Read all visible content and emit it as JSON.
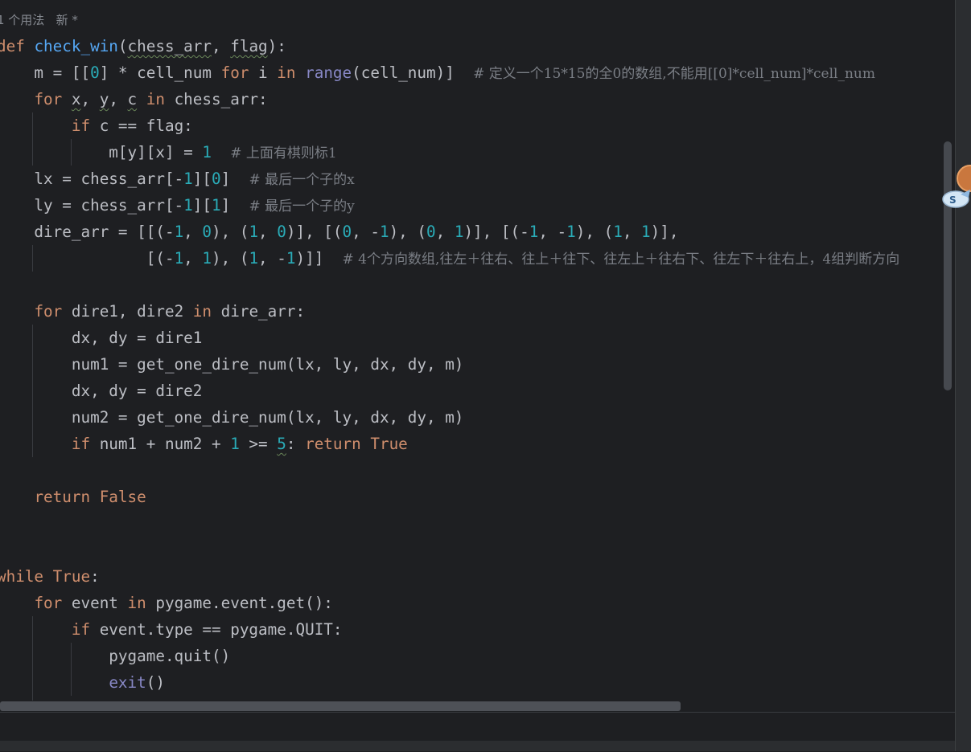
{
  "editor": {
    "usage_hint": "1 个用法   新 *",
    "lines": [
      {
        "id": "l1",
        "tokens": [
          {
            "t": "def ",
            "c": "kw"
          },
          {
            "t": "check_win",
            "c": "fn"
          },
          {
            "t": "("
          },
          {
            "t": "chess_arr",
            "c": "sq"
          },
          {
            "t": ", "
          },
          {
            "t": "flag",
            "c": "sq"
          },
          {
            "t": "):"
          }
        ]
      },
      {
        "id": "l2",
        "tokens": [
          {
            "t": "    m = [["
          },
          {
            "t": "0",
            "c": "num"
          },
          {
            "t": "] * cell_num "
          },
          {
            "t": "for",
            "c": "kw"
          },
          {
            "t": " i "
          },
          {
            "t": "in",
            "c": "kw"
          },
          {
            "t": " "
          },
          {
            "t": "range",
            "c": "bi"
          },
          {
            "t": "(cell_num)]  "
          },
          {
            "t": "# 定义一个15*15的全0的数组,不能用[[0]*cell_num]*cell_num",
            "c": "cm"
          }
        ]
      },
      {
        "id": "l3",
        "tokens": [
          {
            "t": "    "
          },
          {
            "t": "for",
            "c": "kw"
          },
          {
            "t": " "
          },
          {
            "t": "x",
            "c": "sq"
          },
          {
            "t": ", "
          },
          {
            "t": "y",
            "c": "sq"
          },
          {
            "t": ", "
          },
          {
            "t": "c",
            "c": "sq"
          },
          {
            "t": " "
          },
          {
            "t": "in",
            "c": "kw"
          },
          {
            "t": " chess_arr:"
          }
        ]
      },
      {
        "id": "l4",
        "tokens": [
          {
            "t": "        "
          },
          {
            "t": "if",
            "c": "kw"
          },
          {
            "t": " c == flag:"
          }
        ]
      },
      {
        "id": "l5",
        "tokens": [
          {
            "t": "            m[y][x] = "
          },
          {
            "t": "1",
            "c": "num"
          },
          {
            "t": "  "
          },
          {
            "t": "# 上面有棋则标1",
            "c": "cm"
          }
        ]
      },
      {
        "id": "l6",
        "tokens": [
          {
            "t": "    lx = chess_arr[-"
          },
          {
            "t": "1",
            "c": "num"
          },
          {
            "t": "]["
          },
          {
            "t": "0",
            "c": "num"
          },
          {
            "t": "]  "
          },
          {
            "t": "# 最后一个子的x",
            "c": "cm"
          }
        ]
      },
      {
        "id": "l7",
        "tokens": [
          {
            "t": "    ly = chess_arr[-"
          },
          {
            "t": "1",
            "c": "num"
          },
          {
            "t": "]["
          },
          {
            "t": "1",
            "c": "num"
          },
          {
            "t": "]  "
          },
          {
            "t": "# 最后一个子的y",
            "c": "cm"
          }
        ]
      },
      {
        "id": "l8",
        "tokens": [
          {
            "t": "    dire_arr = [[(-"
          },
          {
            "t": "1",
            "c": "num"
          },
          {
            "t": ", "
          },
          {
            "t": "0",
            "c": "num"
          },
          {
            "t": "), ("
          },
          {
            "t": "1",
            "c": "num"
          },
          {
            "t": ", "
          },
          {
            "t": "0",
            "c": "num"
          },
          {
            "t": ")], [("
          },
          {
            "t": "0",
            "c": "num"
          },
          {
            "t": ", -"
          },
          {
            "t": "1",
            "c": "num"
          },
          {
            "t": "), ("
          },
          {
            "t": "0",
            "c": "num"
          },
          {
            "t": ", "
          },
          {
            "t": "1",
            "c": "num"
          },
          {
            "t": ")], [(-"
          },
          {
            "t": "1",
            "c": "num"
          },
          {
            "t": ", -"
          },
          {
            "t": "1",
            "c": "num"
          },
          {
            "t": "), ("
          },
          {
            "t": "1",
            "c": "num"
          },
          {
            "t": ", "
          },
          {
            "t": "1",
            "c": "num"
          },
          {
            "t": ")],"
          }
        ]
      },
      {
        "id": "l9",
        "tokens": [
          {
            "t": "                [(-"
          },
          {
            "t": "1",
            "c": "num"
          },
          {
            "t": ", "
          },
          {
            "t": "1",
            "c": "num"
          },
          {
            "t": "), ("
          },
          {
            "t": "1",
            "c": "num"
          },
          {
            "t": ", -"
          },
          {
            "t": "1",
            "c": "num"
          },
          {
            "t": ")]]  "
          },
          {
            "t": "# 4个方向数组,往左＋往右、往上＋往下、往左上＋往右下、往左下＋往右上，4组判断方向",
            "c": "cm"
          }
        ]
      },
      {
        "id": "l10",
        "tokens": [
          {
            "t": ""
          }
        ]
      },
      {
        "id": "l11",
        "tokens": [
          {
            "t": "    "
          },
          {
            "t": "for",
            "c": "kw"
          },
          {
            "t": " dire1, dire2 "
          },
          {
            "t": "in",
            "c": "kw"
          },
          {
            "t": " dire_arr:"
          }
        ]
      },
      {
        "id": "l12",
        "tokens": [
          {
            "t": "        dx, dy = dire1"
          }
        ]
      },
      {
        "id": "l13",
        "tokens": [
          {
            "t": "        num1 = get_one_dire_num(lx, ly, dx, dy, m)"
          }
        ]
      },
      {
        "id": "l14",
        "tokens": [
          {
            "t": "        dx, dy = dire2"
          }
        ]
      },
      {
        "id": "l15",
        "tokens": [
          {
            "t": "        num2 = get_one_dire_num(lx, ly, dx, dy, m)"
          }
        ]
      },
      {
        "id": "l16",
        "tokens": [
          {
            "t": "        "
          },
          {
            "t": "if",
            "c": "kw"
          },
          {
            "t": " num1 + num2 + "
          },
          {
            "t": "1",
            "c": "num"
          },
          {
            "t": " >= "
          },
          {
            "t": "5",
            "c": "num sq"
          },
          {
            "t": ": "
          },
          {
            "t": "return",
            "c": "kw"
          },
          {
            "t": " "
          },
          {
            "t": "True",
            "c": "kw"
          }
        ]
      },
      {
        "id": "l17",
        "tokens": [
          {
            "t": ""
          }
        ]
      },
      {
        "id": "l18",
        "tokens": [
          {
            "t": "    "
          },
          {
            "t": "return",
            "c": "kw"
          },
          {
            "t": " "
          },
          {
            "t": "False",
            "c": "kw"
          }
        ]
      },
      {
        "id": "l19",
        "tokens": [
          {
            "t": ""
          }
        ]
      },
      {
        "id": "l20",
        "tokens": [
          {
            "t": ""
          }
        ]
      },
      {
        "id": "l21",
        "tokens": [
          {
            "t": "while",
            "c": "kw"
          },
          {
            "t": " "
          },
          {
            "t": "True",
            "c": "kw"
          },
          {
            "t": ":"
          }
        ]
      },
      {
        "id": "l22",
        "tokens": [
          {
            "t": "    "
          },
          {
            "t": "for",
            "c": "kw"
          },
          {
            "t": " event "
          },
          {
            "t": "in",
            "c": "kw"
          },
          {
            "t": " pygame.event.get():"
          }
        ]
      },
      {
        "id": "l23",
        "tokens": [
          {
            "t": "        "
          },
          {
            "t": "if",
            "c": "kw"
          },
          {
            "t": " event.type == pygame.QUIT:"
          }
        ]
      },
      {
        "id": "l24",
        "tokens": [
          {
            "t": "            pygame.quit()"
          }
        ]
      },
      {
        "id": "l25",
        "tokens": [
          {
            "t": "            "
          },
          {
            "t": "exit",
            "c": "bi"
          },
          {
            "t": "()"
          }
        ]
      }
    ]
  },
  "colors": {
    "background": "#1e1f22",
    "keyword": "#cf8e6d",
    "function": "#56a8f5",
    "number": "#2aacb8",
    "builtin": "#8888c6",
    "comment": "#7a7e85",
    "text": "#bcbec4"
  },
  "icons": {
    "mascot": "mascot-sticker-icon"
  }
}
